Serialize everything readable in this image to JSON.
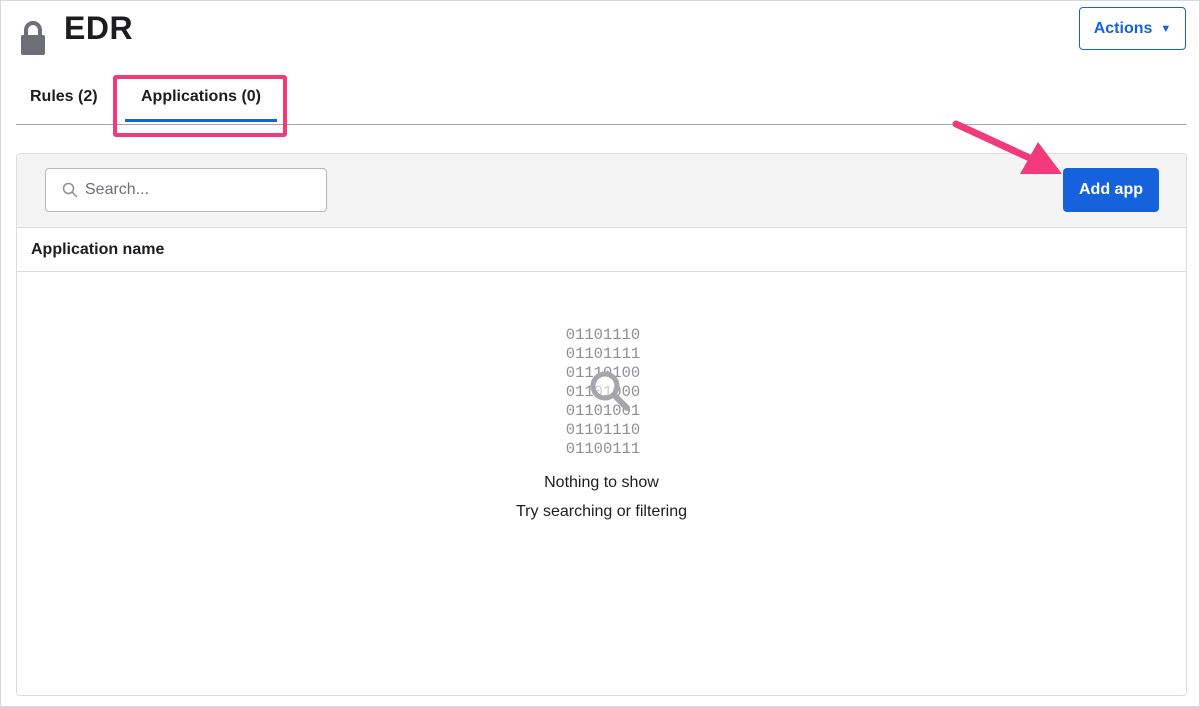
{
  "header": {
    "title": "EDR",
    "actions_label": "Actions",
    "actions_caret": "▼"
  },
  "tabs": [
    {
      "label": "Rules (2)",
      "active": false
    },
    {
      "label": "Applications (0)",
      "active": true
    }
  ],
  "toolbar": {
    "search_placeholder": "Search...",
    "search_value": "",
    "add_app_label": "Add app"
  },
  "table": {
    "columns": [
      "Application name"
    ],
    "rows": []
  },
  "empty_state": {
    "binary_lines": [
      "01101110",
      "01101111",
      "01110100",
      "01101000",
      "01101001",
      "01101110",
      "01100111"
    ],
    "title": "Nothing to show",
    "subtitle": "Try searching or filtering"
  },
  "colors": {
    "primary": "#1662dd",
    "annotation": "#f2397a",
    "text": "#1d1d21",
    "toolbar_bg": "#f4f4f5"
  },
  "icons": {
    "header": "lock-icon",
    "search": "search-icon",
    "empty_state": "magnifier-icon"
  }
}
